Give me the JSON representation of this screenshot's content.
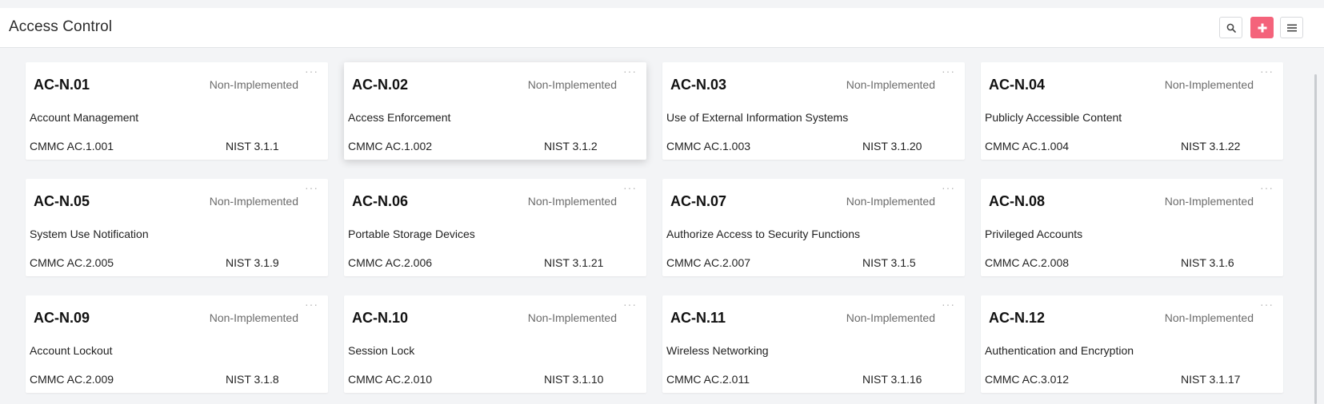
{
  "header": {
    "title": "Access Control",
    "search_icon": "search-icon",
    "add_icon": "plus-icon",
    "menu_icon": "hamburger-menu-icon",
    "accent_color": "#f4637b"
  },
  "cards": [
    {
      "id": "AC-N.01",
      "status": "Non-Implemented",
      "name": "Account Management",
      "cmmc": "CMMC AC.1.001",
      "nist": "NIST 3.1.1"
    },
    {
      "id": "AC-N.02",
      "status": "Non-Implemented",
      "name": "Access Enforcement",
      "cmmc": "CMMC AC.1.002",
      "nist": "NIST 3.1.2"
    },
    {
      "id": "AC-N.03",
      "status": "Non-Implemented",
      "name": "Use of External Information Systems",
      "cmmc": "CMMC AC.1.003",
      "nist": "NIST 3.1.20"
    },
    {
      "id": "AC-N.04",
      "status": "Non-Implemented",
      "name": "Publicly Accessible Content",
      "cmmc": "CMMC AC.1.004",
      "nist": "NIST 3.1.22"
    },
    {
      "id": "AC-N.05",
      "status": "Non-Implemented",
      "name": "System Use Notification",
      "cmmc": "CMMC AC.2.005",
      "nist": "NIST 3.1.9"
    },
    {
      "id": "AC-N.06",
      "status": "Non-Implemented",
      "name": "Portable Storage Devices",
      "cmmc": "CMMC AC.2.006",
      "nist": "NIST 3.1.21"
    },
    {
      "id": "AC-N.07",
      "status": "Non-Implemented",
      "name": "Authorize Access to Security Functions",
      "cmmc": "CMMC AC.2.007",
      "nist": "NIST 3.1.5"
    },
    {
      "id": "AC-N.08",
      "status": "Non-Implemented",
      "name": "Privileged Accounts",
      "cmmc": "CMMC AC.2.008",
      "nist": "NIST 3.1.6"
    },
    {
      "id": "AC-N.09",
      "status": "Non-Implemented",
      "name": "Account Lockout",
      "cmmc": "CMMC AC.2.009",
      "nist": "NIST 3.1.8"
    },
    {
      "id": "AC-N.10",
      "status": "Non-Implemented",
      "name": "Session Lock",
      "cmmc": "CMMC AC.2.010",
      "nist": "NIST 3.1.10"
    },
    {
      "id": "AC-N.11",
      "status": "Non-Implemented",
      "name": "Wireless Networking",
      "cmmc": "CMMC AC.2.011",
      "nist": "NIST 3.1.16"
    },
    {
      "id": "AC-N.12",
      "status": "Non-Implemented",
      "name": "Authentication and Encryption",
      "cmmc": "CMMC AC.3.012",
      "nist": "NIST 3.1.17"
    }
  ],
  "card_more_icon": "more-dots-icon"
}
